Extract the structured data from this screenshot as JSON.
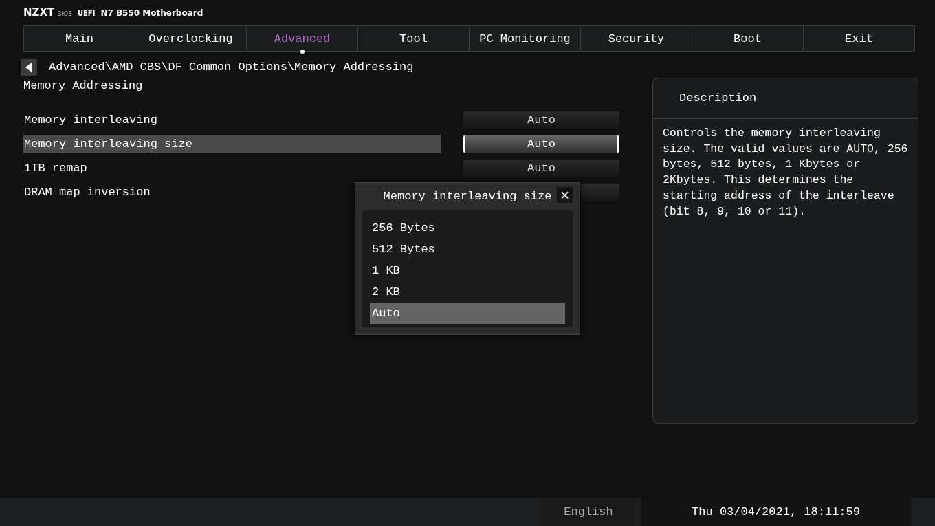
{
  "header": {
    "brand": "NZXT",
    "bios": "BIOS",
    "uefi": "UEFI",
    "model": "N7 B550 Motherboard"
  },
  "tabs": [
    {
      "label": "Main",
      "selected": false
    },
    {
      "label": "Overclocking",
      "selected": false
    },
    {
      "label": "Advanced",
      "selected": true
    },
    {
      "label": "Tool",
      "selected": false
    },
    {
      "label": "PC Monitoring",
      "selected": false
    },
    {
      "label": "Security",
      "selected": false
    },
    {
      "label": "Boot",
      "selected": false
    },
    {
      "label": "Exit",
      "selected": false
    }
  ],
  "breadcrumb": "Advanced\\AMD CBS\\DF Common Options\\Memory Addressing",
  "page_title": "Memory Addressing",
  "settings": [
    {
      "label": "Memory interleaving",
      "value": "Auto",
      "selected": false
    },
    {
      "label": "Memory interleaving size",
      "value": "Auto",
      "selected": true
    },
    {
      "label": "1TB remap",
      "value": "Auto",
      "selected": false
    },
    {
      "label": "DRAM map inversion",
      "selected": false
    }
  ],
  "description": {
    "title": "Description",
    "text": "Controls the memory interleaving size. The valid values are AUTO, 256 bytes, 512 bytes, 1 Kbytes or 2Kbytes. This determines the starting address of the interleave (bit 8, 9, 10 or 11)."
  },
  "dialog": {
    "title": "Memory interleaving size",
    "close": "✕",
    "options": [
      {
        "label": "256 Bytes",
        "selected": false
      },
      {
        "label": "512 Bytes",
        "selected": false
      },
      {
        "label": "1 KB",
        "selected": false
      },
      {
        "label": "2 KB",
        "selected": false
      },
      {
        "label": "Auto",
        "selected": true
      }
    ]
  },
  "status_bar": {
    "language": "English",
    "datetime": "Thu 03/04/2021, 18:11:59"
  }
}
